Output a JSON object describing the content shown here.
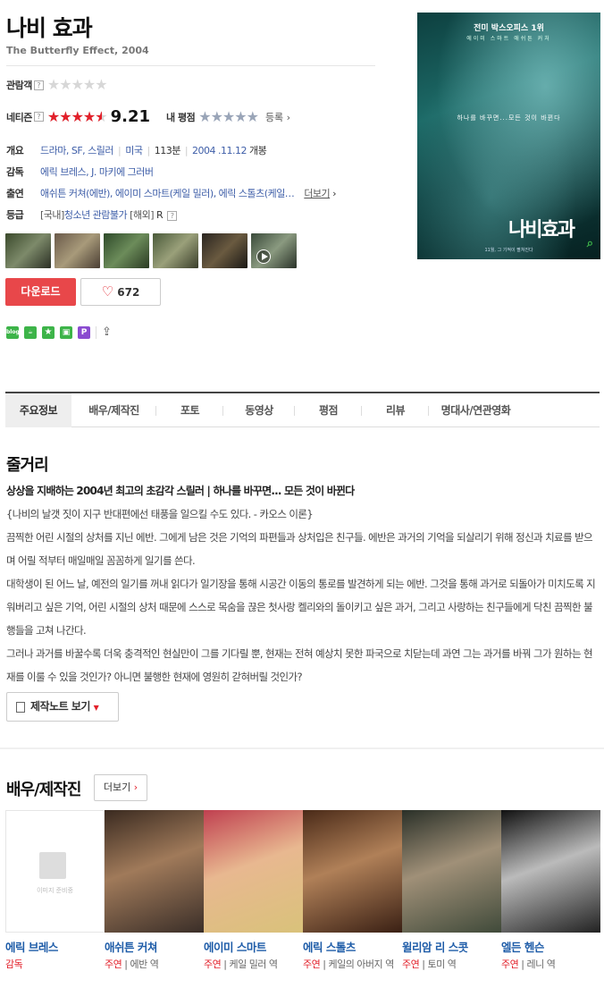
{
  "movie": {
    "title": "나비 효과",
    "subtitle": "The Butterfly Effect, 2004"
  },
  "ratings": {
    "audience_label": "관람객",
    "netizen_label": "네티즌",
    "netizen_score": "9.21",
    "netizen_stars": 4.6,
    "my_label": "내 평점",
    "register_label": "등록",
    "q_mark": "?"
  },
  "info": {
    "overview_label": "개요",
    "genres": "드라마, SF, 스릴러",
    "country": "미국",
    "runtime": "113분",
    "release": "2004 .11.12",
    "release_suffix": "개봉",
    "director_label": "감독",
    "directors": "에릭 브레스, J. 마키에 그러버",
    "cast_label": "출연",
    "cast": "애쉬튼 커쳐(에반), 에이미 스마트(케일 밀러), 에릭 스톨츠(케일…",
    "cast_more": "더보기",
    "grade_label": "등급",
    "grade_domestic_prefix": "[국내]",
    "grade_domestic": "청소년 관람불가",
    "grade_foreign_prefix": "[해외]",
    "grade_foreign": "R"
  },
  "actions": {
    "download": "다운로드",
    "likes": "672"
  },
  "share_icons": [
    "blog",
    "cafe",
    "star",
    "band",
    "pinterest",
    "share-icon"
  ],
  "poster": {
    "top_text": "전미 박스오피스 1위",
    "names": "에이미 스마트   애쉬튼 커처",
    "tagline": "하나를 바꾸면...모든 것이 바뀐다",
    "title": "나비효과",
    "bottom": "11월, 그 기적이 펼쳐진다"
  },
  "tabs": [
    "주요정보",
    "배우/제작진",
    "포토",
    "동영상",
    "평점",
    "리뷰",
    "명대사/연관영화"
  ],
  "story": {
    "heading": "줄거리",
    "tagline": "상상을 지배하는 2004년 최고의 초감각 스릴러 | 하나를 바꾸면... 모든 것이 바뀐다",
    "p1": "{나비의 날갯 짓이 지구 반대편에선 태풍을 일으킬 수도 있다. - 카오스 이론}",
    "p2": "  끔찍한 어린 시절의 상처를 지닌 에반. 그에게 남은 것은 기억의 파편들과 상처입은 친구들. 에반은 과거의 기억을 되살리기 위해 정신과 치료를 받으며 어릴 적부터 매일매일 꼼꼼하게 일기를 쓴다.",
    "p3": "  대학생이 된 어느 날, 예전의 일기를 꺼내 읽다가 일기장을 통해 시공간 이동의 통로를 발견하게 되는 에반. 그것을 통해 과거로 되돌아가 미치도록 지워버리고 싶은 기억, 어린 시절의 상처 때문에 스스로 목숨을 끊은 첫사랑 켈리와의 돌이키고 싶은 과거, 그리고 사랑하는 친구들에게 닥친 끔찍한 불행들을 고쳐 나간다.",
    "p4": "  그러나 과거를 바꿀수록 더욱 충격적인 현실만이 그를 기다릴 뿐, 현재는 전혀 예상치 못한 파국으로 치닫는데 과연 그는 과거를 바꿔 그가 원하는 현재를 이룰 수 있을 것인가? 아니면 불행한 현재에 영원히 갇혀버릴 것인가?",
    "note_button": "제작노트 보기"
  },
  "cast_section": {
    "heading": "배우/제작진",
    "more": "더보기",
    "no_image": "이미지 준비중",
    "people": [
      {
        "name": "에릭 브레스",
        "role": "감독",
        "char": ""
      },
      {
        "name": "애쉬튼 커쳐",
        "role": "주연",
        "char": "에반 역"
      },
      {
        "name": "에이미 스마트",
        "role": "주연",
        "char": "케일 밀러 역"
      },
      {
        "name": "에릭 스톨츠",
        "role": "주연",
        "char": "케일의 아버지 역"
      },
      {
        "name": "윌리암 리 스콧",
        "role": "주연",
        "char": "토미 역"
      },
      {
        "name": "엘든 헨슨",
        "role": "주연",
        "char": "레니 역"
      }
    ]
  }
}
